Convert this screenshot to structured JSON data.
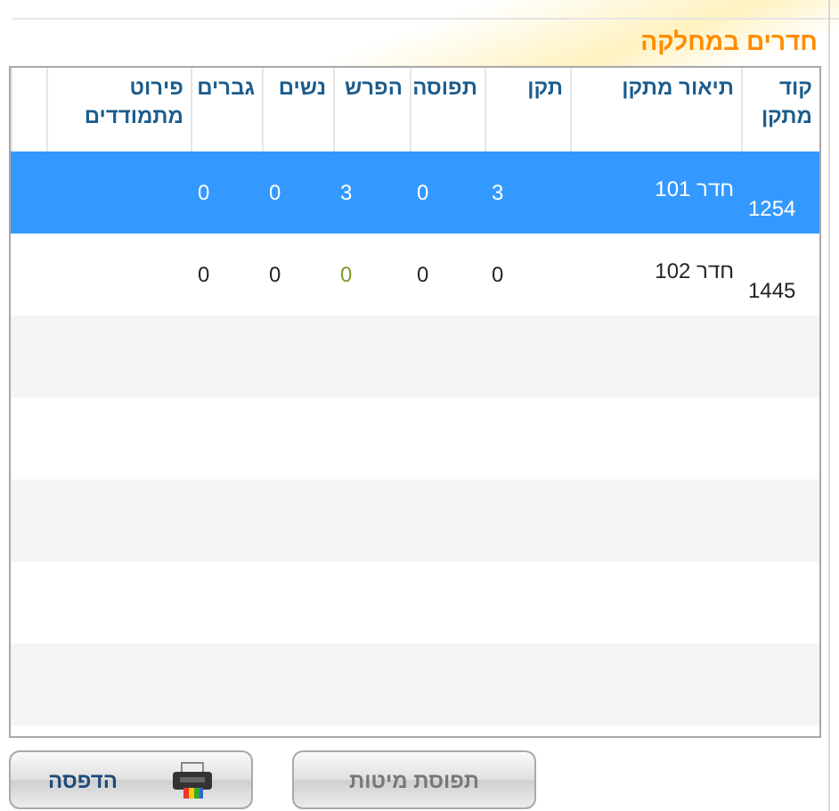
{
  "title": "חדרים במחלקה",
  "table": {
    "columns": [
      "קוד מתקן",
      "תיאור מתקן",
      "תקן",
      "תפוסה",
      "הפרש",
      "נשים",
      "גברים",
      "פירוט מתמודדים"
    ],
    "rows": [
      {
        "selected": true,
        "cells": [
          "1254",
          "חדר 101",
          "3",
          "0",
          "3",
          "0",
          "0",
          ""
        ]
      },
      {
        "selected": false,
        "cells": [
          "1445",
          "חדר 102",
          "0",
          "0",
          "0",
          "0",
          "0",
          ""
        ]
      }
    ]
  },
  "buttons": [
    {
      "kind": "plain",
      "label": "תפוסת מיטות",
      "disabled": true
    },
    {
      "kind": "print",
      "label": "הדפסה",
      "disabled": false
    }
  ]
}
